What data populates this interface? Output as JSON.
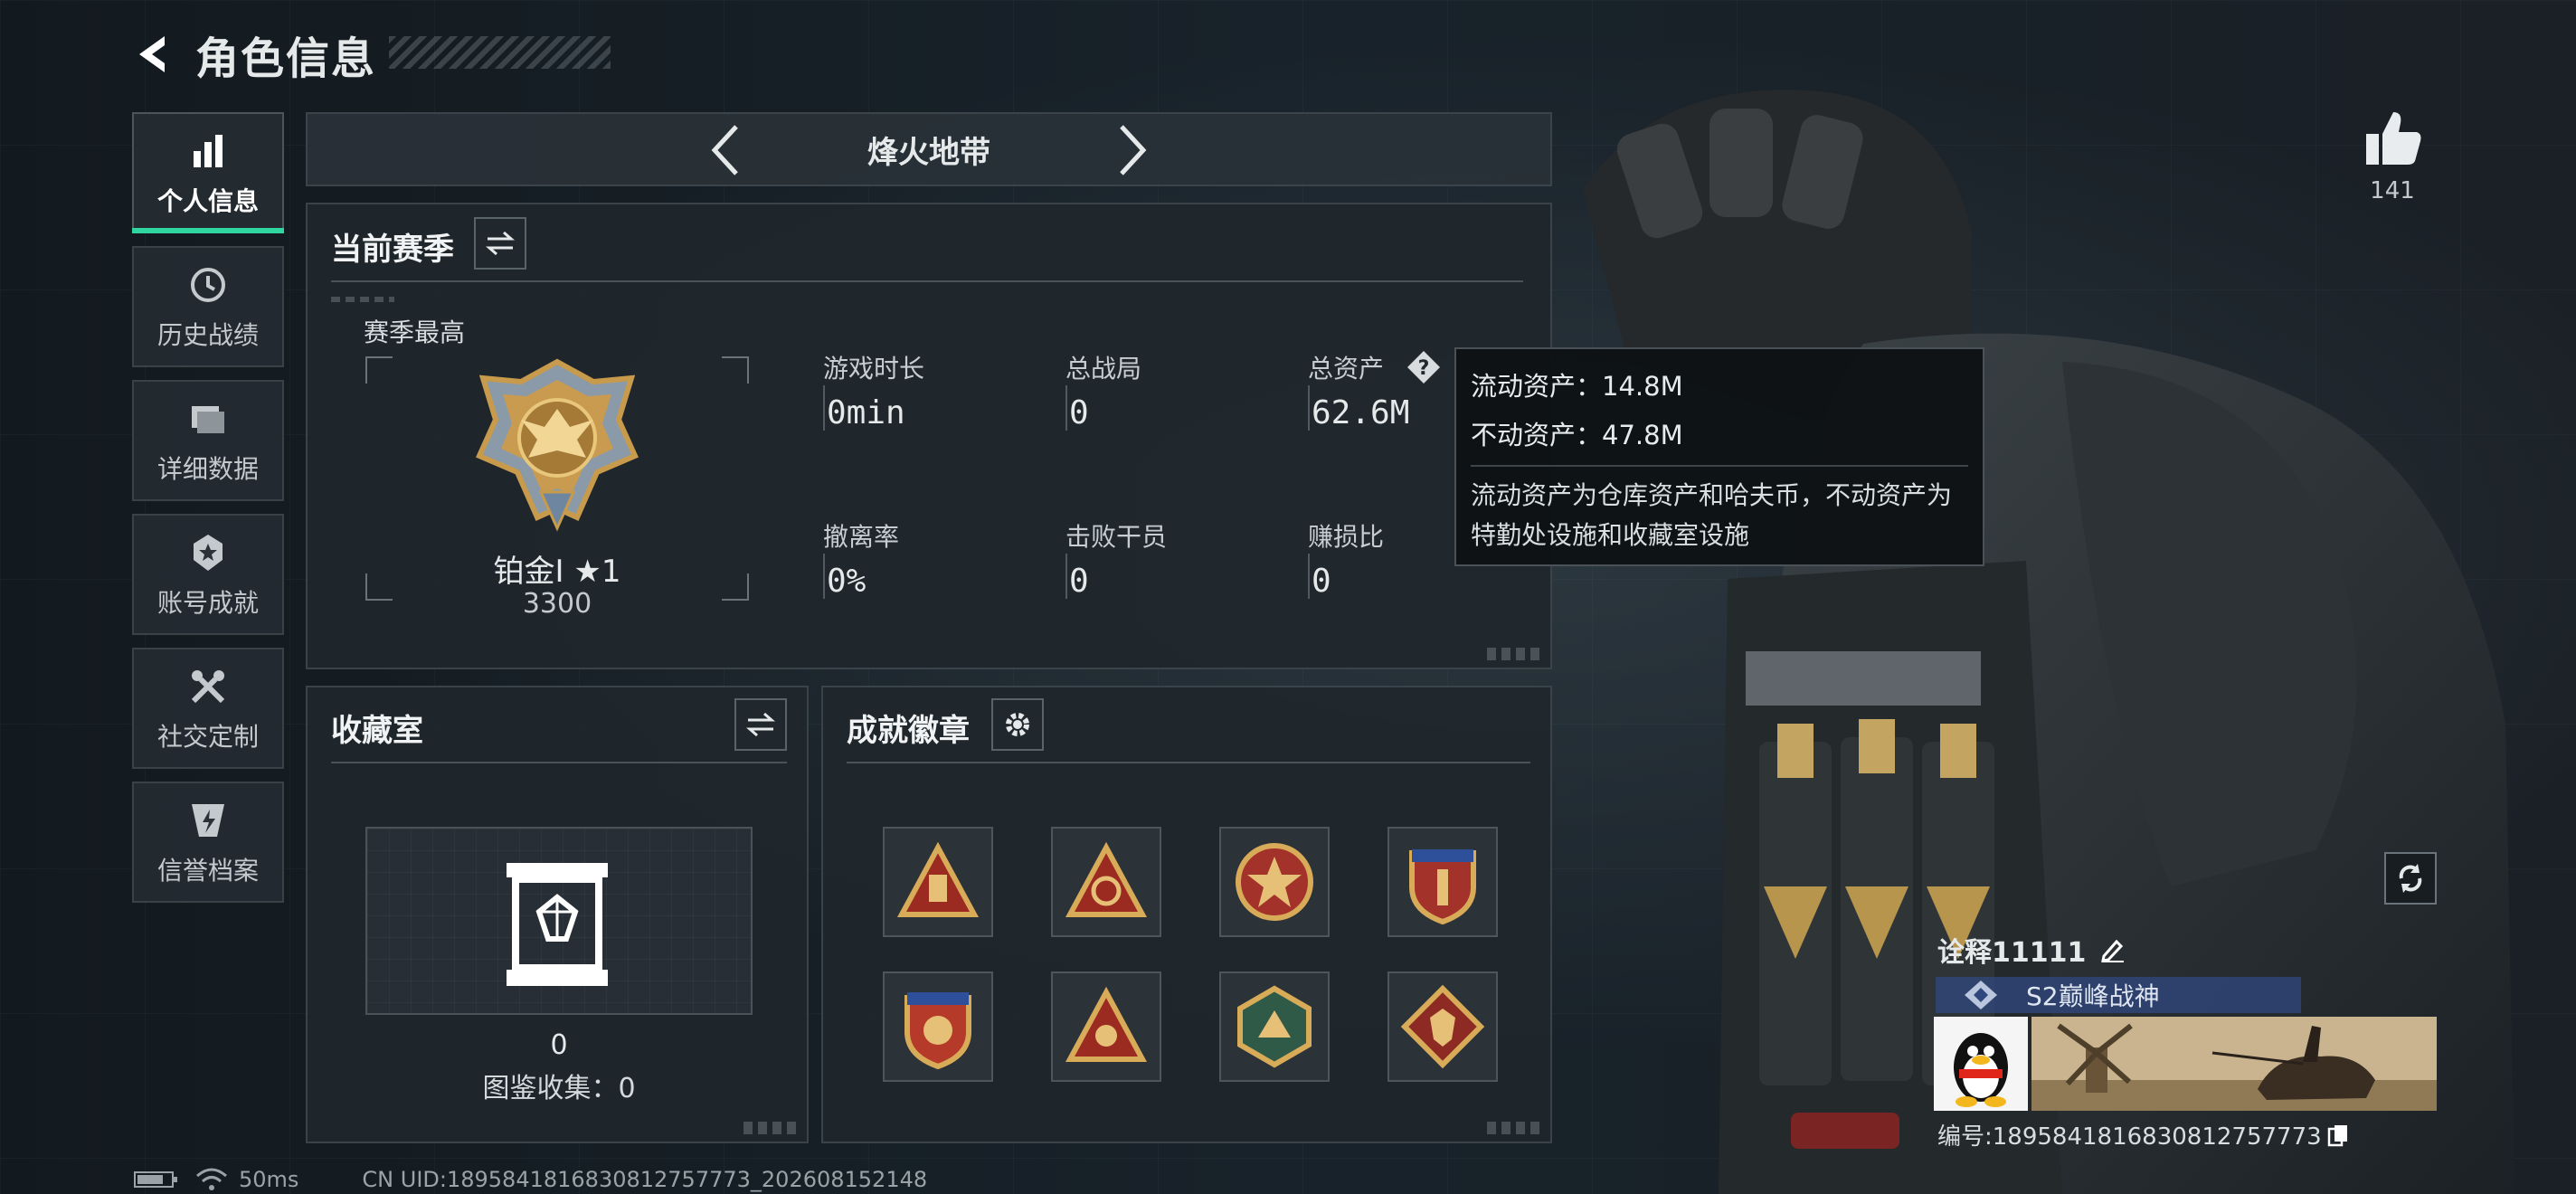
{
  "header": {
    "title": "角色信息"
  },
  "sidenav": {
    "items": [
      {
        "label": "个人信息",
        "icon": "bar-chart-icon",
        "active": true
      },
      {
        "label": "历史战绩",
        "icon": "history-icon"
      },
      {
        "label": "详细数据",
        "icon": "folder-icon"
      },
      {
        "label": "账号成就",
        "icon": "medal-icon"
      },
      {
        "label": "社交定制",
        "icon": "tools-icon"
      },
      {
        "label": "信誉档案",
        "icon": "shield-icon"
      }
    ]
  },
  "mode": {
    "name": "烽火地带"
  },
  "season": {
    "title": "当前赛季",
    "subtitle": "赛季最高",
    "rank_label": "铂金Ⅰ ★1",
    "rank_score": "3300",
    "stats": [
      {
        "label": "游戏时长",
        "value": "0min"
      },
      {
        "label": "总战局",
        "value": "0"
      },
      {
        "label": "总资产",
        "value": "62.6M"
      },
      {
        "label": "撤离率",
        "value": "0%"
      },
      {
        "label": "击败干员",
        "value": "0"
      },
      {
        "label": "赚损比",
        "value": "0"
      }
    ]
  },
  "tooltip": {
    "liquid": "流动资产：14.8M",
    "fixed": "不动资产：47.8M",
    "desc": "流动资产为仓库资产和哈夫币，不动资产为特勤处设施和收藏室设施"
  },
  "collection": {
    "title": "收藏室",
    "count": "0",
    "label": "图鉴收集：0"
  },
  "badges": {
    "title": "成就徽章"
  },
  "likes": {
    "count": "141"
  },
  "player": {
    "name": "诠释11111",
    "title": "S2巅峰战神",
    "id": "编号:1895841816830812757773"
  },
  "footer": {
    "ping": "50ms",
    "uid": "CN UID:1895841816830812757773_202608152148"
  },
  "colors": {
    "accent": "#2fd6a0",
    "panel": "#20272d",
    "tooltip_bg": "#0e1214"
  }
}
